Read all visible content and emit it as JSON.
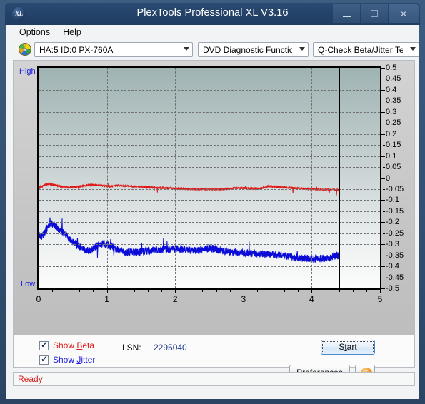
{
  "window": {
    "title": "PlexTools Professional XL V3.16",
    "app_icon": "xl-logo-icon",
    "buttons": {
      "minimize": "minimize-icon",
      "maximize": "maximize-icon",
      "close": "×"
    }
  },
  "menu": {
    "items": [
      {
        "pre": "",
        "accel": "O",
        "post": "ptions"
      },
      {
        "pre": "",
        "accel": "H",
        "post": "elp"
      }
    ]
  },
  "toolbar": {
    "drive_icon": "optical-disc-icon",
    "drive_select": "HA:5 ID:0  PX-760A",
    "function_select": "DVD Diagnostic Functions",
    "test_select": "Q-Check Beta/Jitter Test"
  },
  "controls": {
    "show_beta": {
      "pre": "Show ",
      "accel": "B",
      "post": "eta",
      "checked": true,
      "color": "#e01b1b"
    },
    "show_jitter": {
      "pre": "Show ",
      "accel": "J",
      "post": "itter",
      "checked": true,
      "color": "#1a1ae0"
    },
    "lsn_label": "LSN:",
    "lsn_value": "2295040",
    "start_button": {
      "pre": "S",
      "accel": "t",
      "post": "art"
    },
    "preferences_button": {
      "pre": "",
      "accel": "P",
      "post": "references"
    },
    "info_button": "i"
  },
  "status": {
    "text": "Ready",
    "color": "#d32222"
  },
  "chart_data": {
    "type": "line",
    "title": "",
    "xlabel": "",
    "ylabel": "",
    "xlim": [
      0,
      5
    ],
    "ylim": [
      -0.5,
      0.5
    ],
    "xticks": [
      0,
      1,
      2,
      3,
      4,
      5
    ],
    "yticks": [
      0.5,
      0.45,
      0.4,
      0.35,
      0.3,
      0.25,
      0.2,
      0.15,
      0.1,
      0.05,
      0,
      -0.05,
      -0.1,
      -0.15,
      -0.2,
      -0.25,
      -0.3,
      -0.35,
      -0.4,
      -0.45,
      -0.5
    ],
    "ytick_labels": [
      "0.5",
      "0.45",
      "0.4",
      "0.35",
      "0.3",
      "0.25",
      "0.2",
      "0.15",
      "0.1",
      "0.05",
      "0",
      "-0.05",
      "-0.1",
      "-0.15",
      "-0.2",
      "-0.25",
      "-0.3",
      "-0.35",
      "-0.4",
      "-0.45",
      "-0.5"
    ],
    "axis_left_label": "High",
    "axis_right_label": "Low",
    "grid": true,
    "data_end_x": 4.4,
    "legend": [
      {
        "name": "Beta",
        "color": "#e01b1b"
      },
      {
        "name": "Jitter",
        "color": "#0b0bd8"
      }
    ],
    "series": [
      {
        "name": "Beta",
        "color": "#e01b1b",
        "x": [
          0.0,
          0.05,
          0.1,
          0.15,
          0.2,
          0.25,
          0.3,
          0.35,
          0.4,
          0.45,
          0.5,
          0.55,
          0.6,
          0.65,
          0.7,
          0.75,
          0.8,
          0.85,
          0.9,
          0.95,
          1.0,
          1.05,
          1.1,
          1.15,
          1.2,
          1.25,
          1.3,
          1.35,
          1.4,
          1.45,
          1.5,
          1.55,
          1.6,
          1.65,
          1.7,
          1.75,
          1.8,
          1.85,
          1.9,
          1.95,
          2.0,
          2.05,
          2.1,
          2.15,
          2.2,
          2.25,
          2.3,
          2.35,
          2.4,
          2.45,
          2.5,
          2.55,
          2.6,
          2.65,
          2.7,
          2.75,
          2.8,
          2.85,
          2.9,
          2.95,
          3.0,
          3.05,
          3.1,
          3.15,
          3.2,
          3.25,
          3.3,
          3.35,
          3.4,
          3.45,
          3.5,
          3.55,
          3.6,
          3.65,
          3.7,
          3.75,
          3.8,
          3.85,
          3.9,
          3.95,
          4.0,
          4.05,
          4.1,
          4.15,
          4.2,
          4.25,
          4.3,
          4.35,
          4.4
        ],
        "y": [
          -0.04,
          -0.038,
          -0.03,
          -0.027,
          -0.029,
          -0.033,
          -0.036,
          -0.04,
          -0.041,
          -0.042,
          -0.041,
          -0.04,
          -0.039,
          -0.036,
          -0.033,
          -0.031,
          -0.031,
          -0.032,
          -0.033,
          -0.035,
          -0.036,
          -0.038,
          -0.036,
          -0.034,
          -0.034,
          -0.035,
          -0.036,
          -0.037,
          -0.038,
          -0.039,
          -0.039,
          -0.04,
          -0.041,
          -0.042,
          -0.043,
          -0.043,
          -0.044,
          -0.045,
          -0.045,
          -0.046,
          -0.047,
          -0.047,
          -0.048,
          -0.049,
          -0.049,
          -0.05,
          -0.05,
          -0.05,
          -0.05,
          -0.051,
          -0.051,
          -0.051,
          -0.051,
          -0.05,
          -0.05,
          -0.049,
          -0.048,
          -0.046,
          -0.045,
          -0.045,
          -0.045,
          -0.046,
          -0.046,
          -0.047,
          -0.047,
          -0.048,
          -0.04,
          -0.038,
          -0.038,
          -0.039,
          -0.04,
          -0.041,
          -0.042,
          -0.043,
          -0.044,
          -0.045,
          -0.046,
          -0.047,
          -0.048,
          -0.049,
          -0.05,
          -0.05,
          -0.051,
          -0.051,
          -0.051,
          -0.052,
          -0.052,
          -0.053,
          -0.053
        ],
        "noise": 0.008
      },
      {
        "name": "Jitter",
        "color": "#0b0bd8",
        "x": [
          0.0,
          0.05,
          0.1,
          0.15,
          0.2,
          0.25,
          0.3,
          0.35,
          0.4,
          0.45,
          0.5,
          0.55,
          0.6,
          0.65,
          0.7,
          0.75,
          0.8,
          0.85,
          0.9,
          0.95,
          1.0,
          1.05,
          1.1,
          1.15,
          1.2,
          1.25,
          1.3,
          1.35,
          1.4,
          1.45,
          1.5,
          1.55,
          1.6,
          1.65,
          1.7,
          1.75,
          1.8,
          1.85,
          1.9,
          1.95,
          2.0,
          2.05,
          2.1,
          2.15,
          2.2,
          2.25,
          2.3,
          2.35,
          2.4,
          2.45,
          2.5,
          2.55,
          2.6,
          2.65,
          2.7,
          2.75,
          2.8,
          2.85,
          2.9,
          2.95,
          3.0,
          3.05,
          3.1,
          3.15,
          3.2,
          3.25,
          3.3,
          3.35,
          3.4,
          3.45,
          3.5,
          3.55,
          3.6,
          3.65,
          3.7,
          3.75,
          3.8,
          3.85,
          3.9,
          3.95,
          4.0,
          4.05,
          4.1,
          4.15,
          4.2,
          4.25,
          4.3,
          4.35,
          4.4
        ],
        "y": [
          -0.255,
          -0.268,
          -0.24,
          -0.215,
          -0.205,
          -0.218,
          -0.232,
          -0.245,
          -0.258,
          -0.272,
          -0.288,
          -0.3,
          -0.312,
          -0.32,
          -0.326,
          -0.33,
          -0.322,
          -0.31,
          -0.3,
          -0.296,
          -0.3,
          -0.308,
          -0.315,
          -0.322,
          -0.328,
          -0.332,
          -0.335,
          -0.336,
          -0.336,
          -0.335,
          -0.334,
          -0.332,
          -0.33,
          -0.328,
          -0.327,
          -0.326,
          -0.325,
          -0.324,
          -0.323,
          -0.322,
          -0.322,
          -0.323,
          -0.324,
          -0.325,
          -0.326,
          -0.327,
          -0.328,
          -0.328,
          -0.326,
          -0.322,
          -0.318,
          -0.32,
          -0.324,
          -0.328,
          -0.33,
          -0.332,
          -0.334,
          -0.336,
          -0.337,
          -0.338,
          -0.339,
          -0.34,
          -0.341,
          -0.342,
          -0.343,
          -0.344,
          -0.345,
          -0.346,
          -0.347,
          -0.348,
          -0.349,
          -0.35,
          -0.352,
          -0.354,
          -0.356,
          -0.358,
          -0.36,
          -0.362,
          -0.363,
          -0.364,
          -0.365,
          -0.366,
          -0.366,
          -0.365,
          -0.363,
          -0.36,
          -0.356,
          -0.352,
          -0.348
        ],
        "noise": 0.03
      }
    ]
  }
}
